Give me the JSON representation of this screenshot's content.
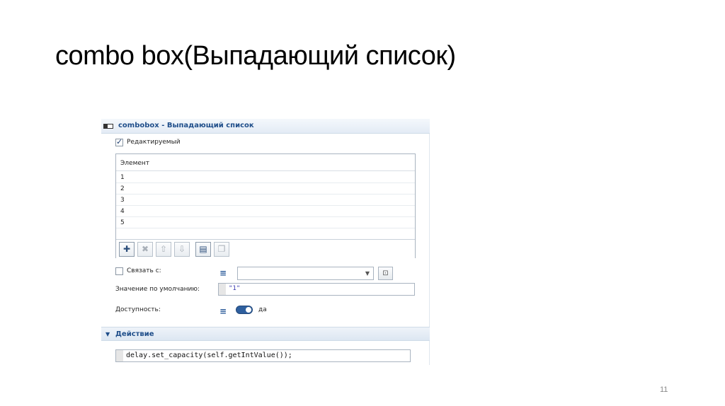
{
  "slide": {
    "title": "combo box(Выпадающий список)",
    "page_number": "11"
  },
  "panel": {
    "title": "combobox - Выпадающий список",
    "editable_label": "Редактируемый",
    "editable_checked": true,
    "list": {
      "header": "Элемент",
      "items": [
        "1",
        "2",
        "3",
        "4",
        "5"
      ]
    },
    "toolbar": {
      "icons": [
        "add-icon",
        "delete-icon",
        "move-up-icon",
        "move-down-icon",
        "paste-icon",
        "copy-icon"
      ]
    },
    "bind_label": "Связать с:",
    "bind_checked": false,
    "default_label": "Значение по умолчанию:",
    "default_value": "\"1\"",
    "availability_label": "Доступность:",
    "availability_value": "да",
    "action_section_title": "Действие",
    "action_code": "delay.set_capacity(self.getIntValue());"
  },
  "colors": {
    "header_text": "#1f4e8a",
    "toggle": "#2e5f9e",
    "string_value": "#3a3ab0"
  }
}
